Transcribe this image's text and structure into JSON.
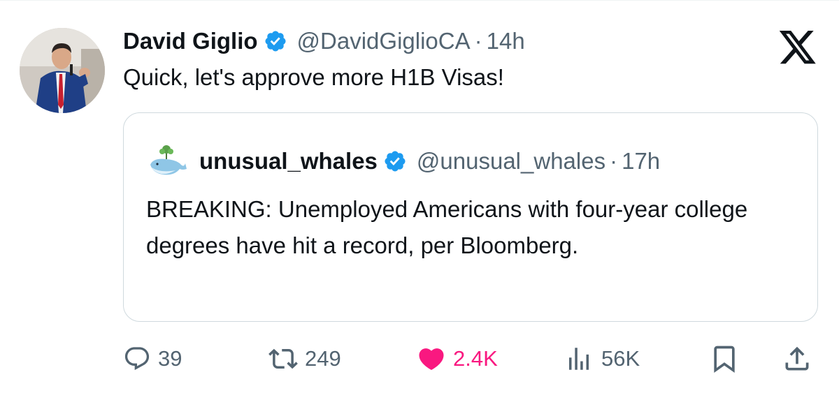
{
  "tweet": {
    "author_name": "David Giglio",
    "author_handle": "@DavidGiglioCA",
    "separator": "·",
    "time": "14h",
    "text": "Quick, let's approve more H1B Visas!"
  },
  "quoted_tweet": {
    "author_name": "unusual_whales",
    "author_handle": "@unusual_whales",
    "separator": "·",
    "time": "17h",
    "text": "BREAKING: Unemployed Americans with four-year college degrees have hit a record, per Bloomberg."
  },
  "actions": {
    "replies": "39",
    "reposts": "249",
    "likes": "2.4K",
    "views": "56K"
  },
  "icons": {
    "verified": "verified-badge-icon",
    "platform": "x-logo-icon",
    "reply": "reply-icon",
    "repost": "repost-icon",
    "like": "heart-icon",
    "views": "views-chart-icon",
    "bookmark": "bookmark-icon",
    "share": "share-icon"
  },
  "colors": {
    "verified_blue": "#1d9bf0",
    "like_pink": "#f91880",
    "muted_gray": "#536471",
    "text": "#0f1419",
    "border": "#cfd9de"
  }
}
